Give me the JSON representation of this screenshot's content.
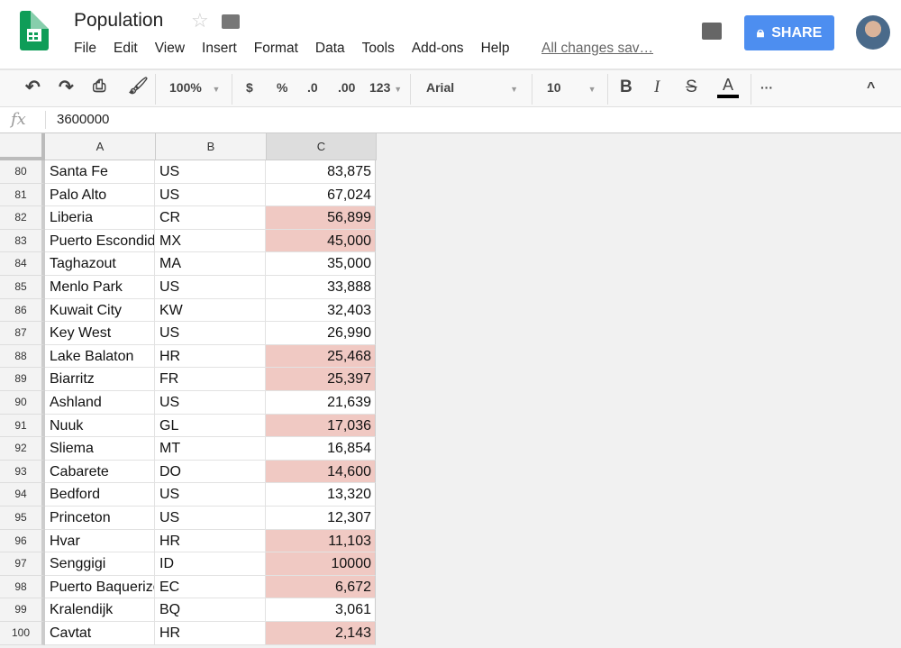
{
  "doc": {
    "title": "Population",
    "saved_status": "All changes sav…"
  },
  "menu": [
    "File",
    "Edit",
    "View",
    "Insert",
    "Format",
    "Data",
    "Tools",
    "Add-ons",
    "Help"
  ],
  "share_label": "SHARE",
  "toolbar": {
    "zoom": "100%",
    "currency": "$",
    "percent": "%",
    "dec_less": ".0",
    "dec_more": ".00",
    "format": "123",
    "font": "Arial",
    "size": "10",
    "bold": "B",
    "italic": "I",
    "strike": "S",
    "textcolor": "A",
    "more": "···",
    "collapse": "^"
  },
  "formula": {
    "label": "fx",
    "value": "3600000"
  },
  "columns": [
    "A",
    "B",
    "C"
  ],
  "colors": {
    "highlight": "#f0c9c3",
    "share": "#4d8ef0"
  },
  "rows": [
    {
      "n": "80",
      "a": "Santa Fe",
      "b": "US",
      "c": "83,875",
      "hl": false
    },
    {
      "n": "81",
      "a": "Palo Alto",
      "b": "US",
      "c": "67,024",
      "hl": false
    },
    {
      "n": "82",
      "a": "Liberia",
      "b": "CR",
      "c": "56,899",
      "hl": true
    },
    {
      "n": "83",
      "a": "Puerto Escondido",
      "b": "MX",
      "c": "45,000",
      "hl": true
    },
    {
      "n": "84",
      "a": "Taghazout",
      "b": "MA",
      "c": "35,000",
      "hl": false
    },
    {
      "n": "85",
      "a": "Menlo Park",
      "b": "US",
      "c": "33,888",
      "hl": false
    },
    {
      "n": "86",
      "a": "Kuwait City",
      "b": "KW",
      "c": "32,403",
      "hl": false
    },
    {
      "n": "87",
      "a": "Key West",
      "b": "US",
      "c": "26,990",
      "hl": false
    },
    {
      "n": "88",
      "a": "Lake Balaton",
      "b": "HR",
      "c": "25,468",
      "hl": true
    },
    {
      "n": "89",
      "a": "Biarritz",
      "b": "FR",
      "c": "25,397",
      "hl": true
    },
    {
      "n": "90",
      "a": "Ashland",
      "b": "US",
      "c": "21,639",
      "hl": false
    },
    {
      "n": "91",
      "a": "Nuuk",
      "b": "GL",
      "c": "17,036",
      "hl": true
    },
    {
      "n": "92",
      "a": "Sliema",
      "b": "MT",
      "c": "16,854",
      "hl": false
    },
    {
      "n": "93",
      "a": "Cabarete",
      "b": "DO",
      "c": "14,600",
      "hl": true
    },
    {
      "n": "94",
      "a": "Bedford",
      "b": "US",
      "c": "13,320",
      "hl": false
    },
    {
      "n": "95",
      "a": "Princeton",
      "b": "US",
      "c": "12,307",
      "hl": false
    },
    {
      "n": "96",
      "a": "Hvar",
      "b": "HR",
      "c": "11,103",
      "hl": true
    },
    {
      "n": "97",
      "a": "Senggigi",
      "b": "ID",
      "c": "10000",
      "hl": true
    },
    {
      "n": "98",
      "a": "Puerto Baquerizo",
      "b": "EC",
      "c": "6,672",
      "hl": true
    },
    {
      "n": "99",
      "a": "Kralendijk",
      "b": "BQ",
      "c": "3,061",
      "hl": false
    },
    {
      "n": "100",
      "a": "Cavtat",
      "b": "HR",
      "c": "2,143",
      "hl": true
    }
  ]
}
